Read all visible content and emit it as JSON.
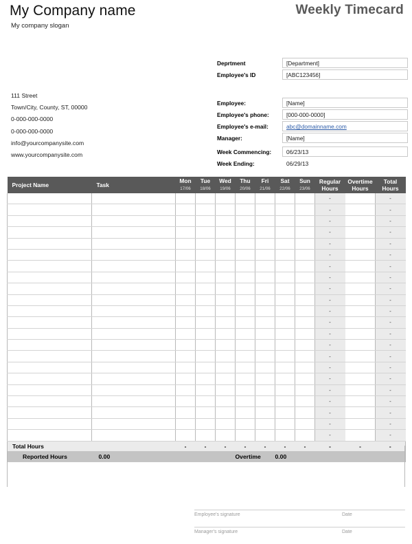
{
  "header": {
    "company_name": "My Company name",
    "company_slogan": "My company slogan",
    "doc_title": "Weekly Timecard"
  },
  "address": {
    "lines": [
      "111 Street",
      "Town/City, County, ST, 00000",
      "0-000-000-0000",
      "0-000-000-0000",
      "info@yourcompanysite.com",
      "www.yourcompanysite.com"
    ]
  },
  "department_block": {
    "rows": [
      {
        "label": "Deprtment",
        "value": "[Department]"
      },
      {
        "label": "Employee's ID",
        "value": "[ABC123456]"
      }
    ]
  },
  "employee_block": {
    "rows": [
      {
        "label": "Employee:",
        "value": "[Name]"
      },
      {
        "label": "Employee's phone:",
        "value": "[000-000-0000]"
      },
      {
        "label": "Employee's e-mail:",
        "value": "abc@domainname.com"
      },
      {
        "label": "Manager:",
        "value": "[Name]"
      }
    ]
  },
  "week_block": {
    "rows": [
      {
        "label": "Week Commencing:",
        "value": "06/23/13"
      },
      {
        "label": "Week Ending:",
        "value": "06/29/13"
      }
    ]
  },
  "table": {
    "headers": {
      "project_name": "Project Name",
      "task": "Task",
      "days": [
        {
          "name": "Mon",
          "date": "17/06"
        },
        {
          "name": "Tue",
          "date": "18/06"
        },
        {
          "name": "Wed",
          "date": "19/06"
        },
        {
          "name": "Thu",
          "date": "20/06"
        },
        {
          "name": "Fri",
          "date": "21/06"
        },
        {
          "name": "Sat",
          "date": "22/06"
        },
        {
          "name": "Sun",
          "date": "23/06"
        }
      ],
      "regular_hours_1": "Regular",
      "regular_hours_2": "Hours",
      "overtime_hours_1": "Overtime",
      "overtime_hours_2": "Hours",
      "total_hours_1": "Total",
      "total_hours_2": "Hours"
    },
    "row_count": 22,
    "empty_value": "",
    "dash_value": "-",
    "total_row": {
      "label": "Total Hours",
      "day_totals": [
        "-",
        "-",
        "-",
        "-",
        "-",
        "-",
        "-"
      ],
      "regular": "-",
      "overtime": "-",
      "total": "-"
    },
    "reported_row": {
      "reported_label": "Reported Hours",
      "reported_value": "0.00",
      "overtime_label": "Overtime",
      "overtime_value": "0.00"
    }
  },
  "signatures": [
    {
      "label": "Employee's signature",
      "date_label": "Date"
    },
    {
      "label": "Manager's signature",
      "date_label": "Date"
    }
  ],
  "colors": {
    "header_bar": "#595959",
    "shaded_cell": "#ebebeb",
    "reported_bar": "#c4c4c4",
    "link": "#2d5ca8",
    "title": "#595959"
  }
}
